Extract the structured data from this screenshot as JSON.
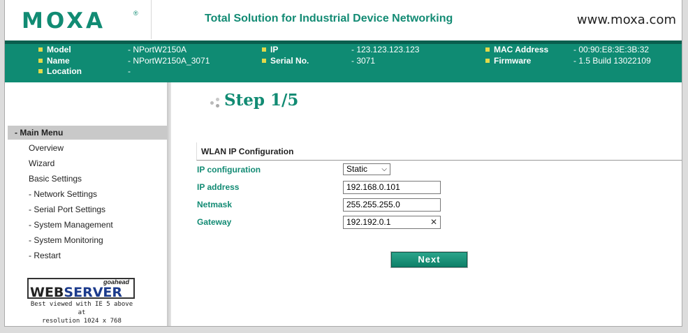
{
  "header": {
    "logo": "MOXA",
    "logo_mark": "®",
    "tagline": "Total Solution for Industrial Device Networking",
    "website": "www.moxa.com"
  },
  "device_info": {
    "model_label": "Model",
    "model_value": "- NPortW2150A",
    "name_label": "Name",
    "name_value": "- NPortW2150A_3071",
    "location_label": "Location",
    "location_value": "-",
    "ip_label": "IP",
    "ip_value": "- 123.123.123.123",
    "serial_label": "Serial No.",
    "serial_value": "- 3071",
    "mac_label": "MAC Address",
    "mac_value": "- 00:90:E8:3E:3B:32",
    "firmware_label": "Firmware",
    "firmware_value": "- 1.5 Build 13022109"
  },
  "sidebar": {
    "main_menu": "- Main Menu",
    "items": [
      {
        "label": "Overview"
      },
      {
        "label": "Wizard"
      },
      {
        "label": "Basic Settings"
      },
      {
        "label": "- Network Settings"
      },
      {
        "label": "- Serial Port Settings"
      },
      {
        "label": "- System Management"
      },
      {
        "label": "- System Monitoring"
      },
      {
        "label": "- Restart"
      }
    ],
    "webserver": {
      "goahead": "goahead",
      "web": "WEB",
      "server": "SERVER",
      "note_line1": "Best viewed with IE 5 above at",
      "note_line2": "resolution 1024 x 768"
    }
  },
  "content": {
    "step_title": "Step 1/5",
    "section_title": "WLAN IP Configuration",
    "fields": {
      "ip_configuration": {
        "label": "IP configuration",
        "value": "Static"
      },
      "ip_address": {
        "label": "IP address",
        "value": "192.168.0.101"
      },
      "netmask": {
        "label": "Netmask",
        "value": "255.255.255.0"
      },
      "gateway": {
        "label": "Gateway",
        "value": "192.192.0.1"
      }
    },
    "next_label": "Next"
  }
}
